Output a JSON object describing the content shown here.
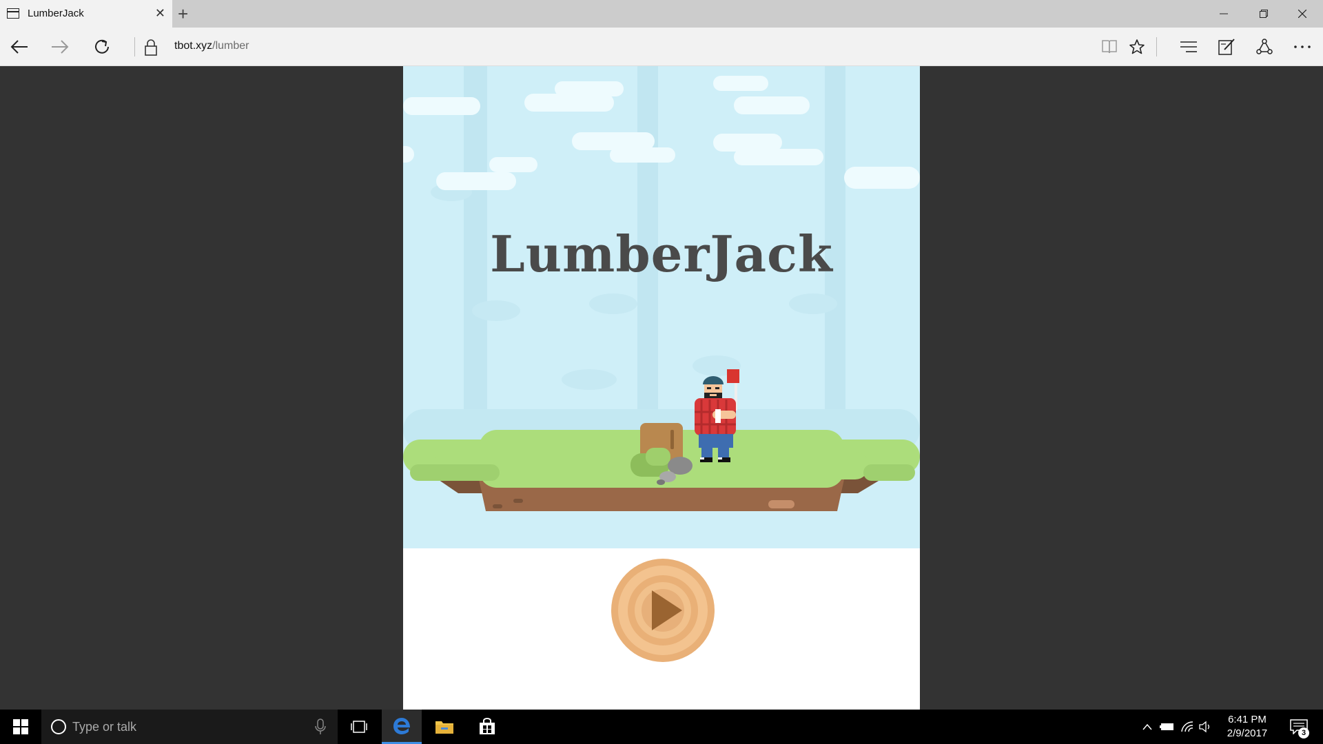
{
  "browser": {
    "tab_title": "LumberJack",
    "tab_close": "✕",
    "new_tab": "+",
    "url_host": "tbot.xyz",
    "url_path": "/lumber"
  },
  "game": {
    "title": "LumberJack",
    "play_button_icon": "play-icon",
    "colors": {
      "sky": "#cfeff8",
      "grass": "#acdd7b",
      "dirt": "#9a6848",
      "wood": "#e9b077",
      "title": "#4a4a4a"
    }
  },
  "taskbar": {
    "search_placeholder": "Type or talk",
    "time": "6:41 PM",
    "date": "2/9/2017",
    "notification_count": "3"
  }
}
